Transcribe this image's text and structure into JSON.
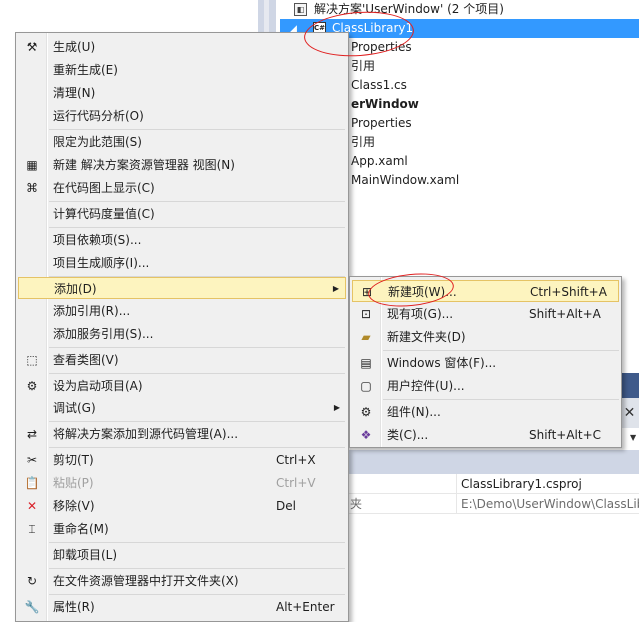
{
  "solution_explorer": {
    "solution_label": "解决方案'UserWindow' (2 个项目)",
    "selected_project": "ClassLibrary1",
    "tree_items": [
      {
        "label": "Properties",
        "bold": false
      },
      {
        "label": "引用",
        "bold": false
      },
      {
        "label": "Class1.cs",
        "bold": false
      },
      {
        "label": "erWindow",
        "bold": true
      },
      {
        "label": "Properties",
        "bold": false
      },
      {
        "label": "引用",
        "bold": false
      },
      {
        "label": "App.xaml",
        "bold": false
      },
      {
        "label": "MainWindow.xaml",
        "bold": false
      }
    ]
  },
  "properties_panel": {
    "close_glyph": "✕",
    "rows": [
      {
        "key": "",
        "value": "ClassLibrary1.csproj"
      },
      {
        "key": "夹",
        "value": "E:\\Demo\\UserWindow\\ClassLib"
      }
    ]
  },
  "context_menu": {
    "items": [
      {
        "label": "生成(U)",
        "icon": "build-icon",
        "glyph": "⚒"
      },
      {
        "label": "重新生成(E)"
      },
      {
        "label": "清理(N)"
      },
      {
        "label": "运行代码分析(O)"
      },
      {
        "label": "限定为此范围(S)"
      },
      {
        "label": "新建 解决方案资源管理器 视图(N)",
        "icon": "new-view-icon",
        "glyph": "▦"
      },
      {
        "label": "在代码图上显示(C)",
        "icon": "code-map-icon",
        "glyph": "⌘"
      },
      {
        "label": "计算代码度量值(C)"
      },
      {
        "label": "项目依赖项(S)..."
      },
      {
        "label": "项目生成顺序(I)..."
      },
      {
        "label": "添加(D)",
        "submenu": true
      },
      {
        "label": "添加引用(R)..."
      },
      {
        "label": "添加服务引用(S)..."
      },
      {
        "label": "查看类图(V)",
        "icon": "class-diagram-icon",
        "glyph": "⬚"
      },
      {
        "label": "设为启动项目(A)",
        "icon": "gear-icon",
        "glyph": "⚙"
      },
      {
        "label": "调试(G)",
        "submenu": true
      },
      {
        "label": "将解决方案添加到源代码管理(A)...",
        "icon": "source-control-icon",
        "glyph": "⇄"
      },
      {
        "label": "剪切(T)",
        "icon": "cut-icon",
        "glyph": "✂",
        "shortcut": "Ctrl+X"
      },
      {
        "label": "粘贴(P)",
        "icon": "paste-icon",
        "glyph": "📋",
        "shortcut": "Ctrl+V",
        "disabled": true
      },
      {
        "label": "移除(V)",
        "icon": "remove-icon",
        "glyph": "✕",
        "shortcut": "Del"
      },
      {
        "label": "重命名(M)",
        "icon": "rename-icon",
        "glyph": "⌶"
      },
      {
        "label": "卸载项目(L)"
      },
      {
        "label": "在文件资源管理器中打开文件夹(X)",
        "icon": "refresh-icon",
        "glyph": "↻"
      },
      {
        "label": "属性(R)",
        "icon": "wrench-icon",
        "glyph": "🔧",
        "shortcut": "Alt+Enter"
      }
    ],
    "submenu_arrow": "▶"
  },
  "add_submenu": {
    "items": [
      {
        "label": "新建项(W)...",
        "icon": "new-item-icon",
        "glyph": "⊞",
        "shortcut": "Ctrl+Shift+A"
      },
      {
        "label": "现有项(G)...",
        "icon": "existing-item-icon",
        "glyph": "⊡",
        "shortcut": "Shift+Alt+A"
      },
      {
        "label": "新建文件夹(D)",
        "icon": "new-folder-icon",
        "glyph": "▰"
      },
      {
        "label": "Windows 窗体(F)...",
        "icon": "windows-form-icon",
        "glyph": "▤"
      },
      {
        "label": "用户控件(U)...",
        "icon": "user-control-icon",
        "glyph": "▢"
      },
      {
        "label": "组件(N)...",
        "icon": "component-icon",
        "glyph": "⚙"
      },
      {
        "label": "类(C)...",
        "icon": "class-icon",
        "glyph": "❖",
        "shortcut": "Shift+Alt+C"
      }
    ]
  },
  "colors": {
    "selection": "#3399ff",
    "menu_bg": "#f0f0f0",
    "highlight_bg": "#fdf4bf",
    "highlight_border": "#e5c365",
    "annotation": "#e02020",
    "remove_icon": "#d9222a"
  }
}
